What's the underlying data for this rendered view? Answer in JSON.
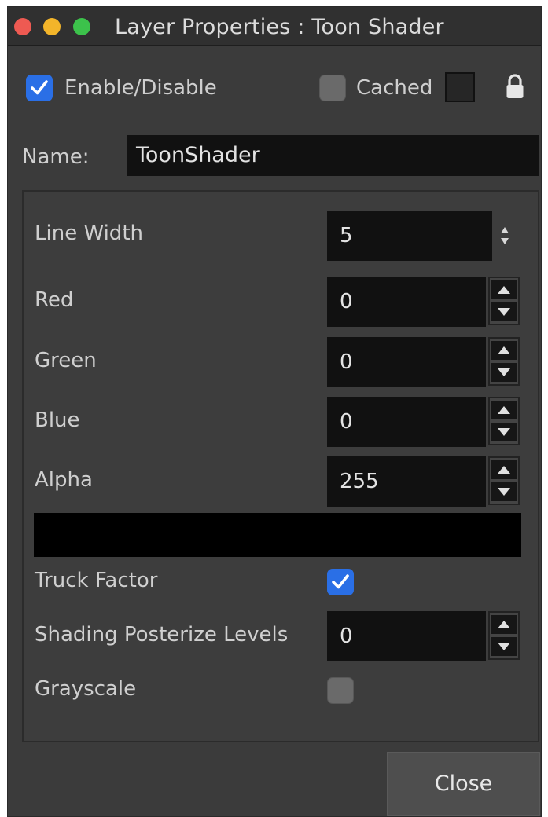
{
  "window": {
    "title": "Layer Properties : Toon Shader"
  },
  "header": {
    "enable_label": "Enable/Disable",
    "enable_checked": true,
    "cached_label": "Cached",
    "cached_checked": false
  },
  "name_row": {
    "label": "Name:",
    "value": "ToonShader"
  },
  "params": {
    "line_width": {
      "label": "Line Width",
      "value": "5"
    },
    "red": {
      "label": "Red",
      "value": "0"
    },
    "green": {
      "label": "Green",
      "value": "0"
    },
    "blue": {
      "label": "Blue",
      "value": "0"
    },
    "alpha": {
      "label": "Alpha",
      "value": "255"
    },
    "color_preview": "#000000",
    "truck_factor": {
      "label": "Truck Factor",
      "checked": true
    },
    "posterize": {
      "label": "Shading Posterize Levels",
      "value": "0"
    },
    "grayscale": {
      "label": "Grayscale",
      "checked": false
    }
  },
  "footer": {
    "close_label": "Close"
  },
  "icons": {
    "lock": "lock-icon",
    "checkmark": "checkmark-icon",
    "up_arrow": "up-arrow-icon",
    "down_arrow": "down-arrow-icon",
    "updown": "updown-arrows-icon"
  },
  "colors": {
    "accent": "#2a6fe6",
    "window_bg": "#3b3b3b",
    "field_bg": "#111111"
  }
}
